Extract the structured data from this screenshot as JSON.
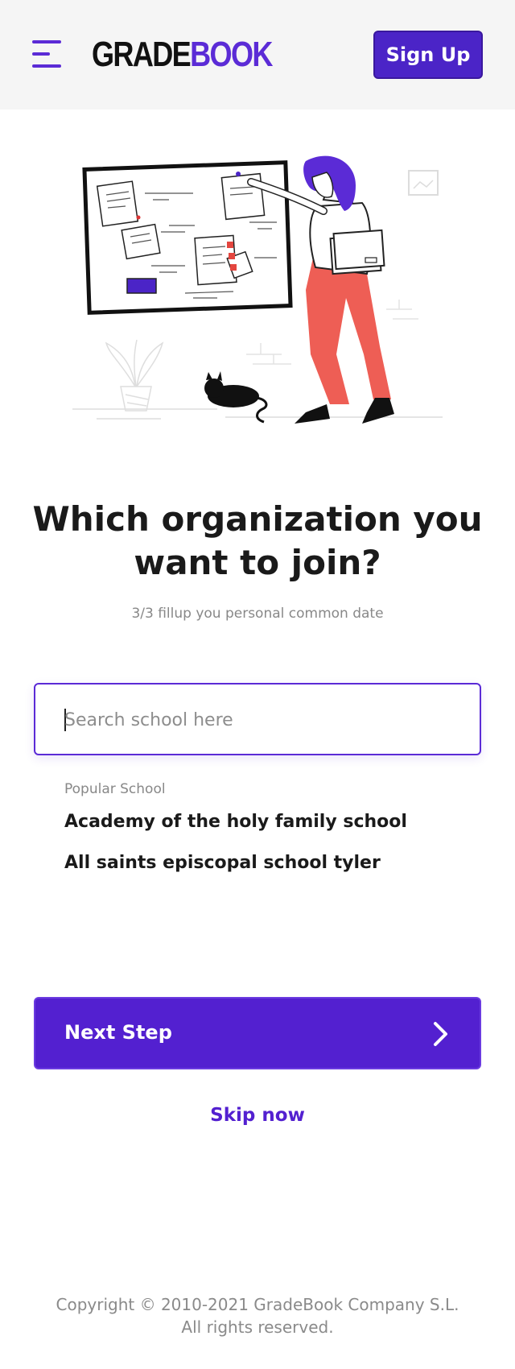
{
  "header": {
    "logo_part1": "GRADE",
    "logo_part2": "BOOK",
    "signup_label": "Sign Up",
    "menu_icon": "hamburger-menu-icon",
    "accent_color": "#5b2bd6"
  },
  "main": {
    "title": "Which organization you want to join?",
    "subtitle": "3/3 fillup you personal common date",
    "search_placeholder": "Search school here",
    "search_value": "",
    "popular_label": "Popular School",
    "schools": [
      "Academy of the holy family school",
      "All saints episcopal school tyler"
    ],
    "next_label": "Next Step",
    "next_icon": "chevron-right-icon",
    "skip_label": "Skip now"
  },
  "footer": {
    "copyright": "Copyright © 2010-2021 GradeBook Company S.L. All rights reserved."
  }
}
